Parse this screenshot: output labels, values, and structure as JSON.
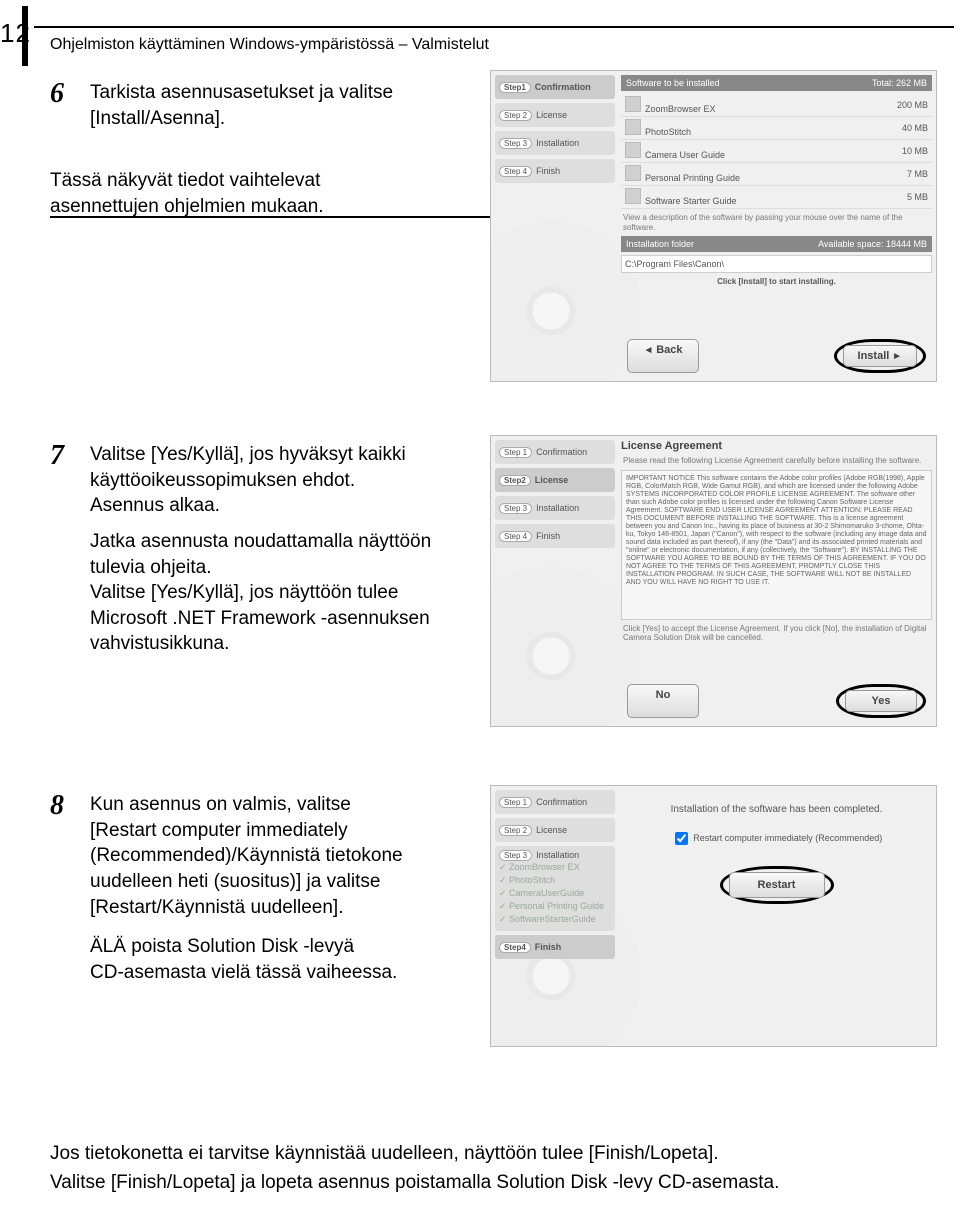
{
  "page_number": "12",
  "breadcrumb": "Ohjelmiston käyttäminen Windows-ympäristössä – Valmistelut",
  "step6": {
    "num": "6",
    "line1": "Tarkista asennusasetukset ja valitse",
    "line2": "[Install/Asenna].",
    "note1": "Tässä näkyvät tiedot vaihtelevat",
    "note2": "asennettujen ohjelmien mukaan."
  },
  "step7": {
    "num": "7",
    "line1": "Valitse [Yes/Kyllä], jos hyväksyt kaikki",
    "line2": "käyttöoikeussopimuksen ehdot.",
    "line3": "Asennus alkaa.",
    "line4": "Jatka asennusta noudattamalla näyttöön",
    "line5": "tulevia ohjeita.",
    "line6": "Valitse [Yes/Kyllä], jos näyttöön tulee",
    "line7": "Microsoft .NET Framework -asennuksen",
    "line8": "vahvistusikkuna."
  },
  "step8": {
    "num": "8",
    "line1": "Kun asennus on valmis, valitse",
    "line2": "[Restart computer immediately",
    "line3": "(Recommended)/Käynnistä tietokone",
    "line4": "uudelleen heti (suositus)] ja valitse",
    "line5": "[Restart/Käynnistä uudelleen].",
    "line6": "ÄLÄ poista Solution Disk -levyä",
    "line7": "CD-asemasta vielä tässä vaiheessa."
  },
  "bottom": {
    "line1": "Jos tietokonetta ei tarvitse käynnistää uudelleen, näyttöön tulee [Finish/Lopeta].",
    "line2": "Valitse [Finish/Lopeta] ja lopeta asennus poistamalla Solution Disk -levy CD-asemasta."
  },
  "shot1": {
    "steps": {
      "s1": "Confirmation",
      "s2": "License",
      "s3": "Installation",
      "s4": "Finish"
    },
    "band_title": "Software to be installed",
    "band_total": "Total: 262 MB",
    "items": [
      {
        "name": "ZoomBrowser EX",
        "size": "200 MB"
      },
      {
        "name": "PhotoStitch",
        "size": "40 MB"
      },
      {
        "name": "Camera User Guide",
        "size": "10 MB"
      },
      {
        "name": "Personal Printing Guide",
        "size": "7 MB"
      },
      {
        "name": "Software Starter Guide",
        "size": "5 MB"
      }
    ],
    "desc_hint": "View a description of the software by passing your mouse over the name of the software.",
    "folder_label": "Installation folder",
    "folder_avail": "Available space: 18444 MB",
    "folder_path": "C:\\Program Files\\Canon\\",
    "click_hint": "Click [Install] to start installing.",
    "back": "Back",
    "install": "Install"
  },
  "shot2": {
    "title": "License Agreement",
    "intro": "Please read the following License Agreement carefully before installing the software.",
    "body": "IMPORTANT NOTICE\nThis software contains the Adobe color profiles (Adobe RGB(1998), Apple RGB, ColorMatch RGB, Wide Gamut RGB), and which are licensed under the following Adobe SYSTEMS INCORPORATED COLOR PROFILE LICENSE AGREEMENT. The software other than such Adobe color profiles is licensed under the following Canon Software License Agreement.\n\nSOFTWARE END USER LICENSE AGREEMENT\nATTENTION: PLEASE READ THIS DOCUMENT BEFORE INSTALLING THE SOFTWARE.\nThis is a license agreement between you and Canon Inc., having its place of business at 30-2 Shimomaruko 3-chome, Ohta-ku, Tokyo 146-8501, Japan (\"Canon\"), with respect to the software (including any image data and sound data included as part thereof), if any (the \"Data\") and its associated printed materials and \"online\" or electronic documentation, if any (collectively, the \"Software\").\nBY INSTALLING THE SOFTWARE YOU AGREE TO BE BOUND BY THE TERMS OF THIS AGREEMENT. IF YOU DO NOT AGREE TO THE TERMS OF THIS AGREEMENT, PROMPTLY CLOSE THIS INSTALLATION PROGRAM. IN SUCH CASE, THE SOFTWARE WILL NOT BE INSTALLED AND YOU WILL HAVE NO RIGHT TO USE IT.",
    "click_hint": "Click [Yes] to accept the License Agreement. If you click [No], the installation of Digital Camera Solution Disk will be cancelled.",
    "no": "No",
    "yes": "Yes"
  },
  "shot3": {
    "msg": "Installation of the software has been completed.",
    "checkbox": "Restart computer immediately (Recommended)",
    "restart": "Restart",
    "items": [
      "ZoomBrowser EX",
      "PhotoStitch",
      "CameraUserGuide",
      "Personal Printing Guide",
      "SoftwareStarterGuide"
    ]
  }
}
